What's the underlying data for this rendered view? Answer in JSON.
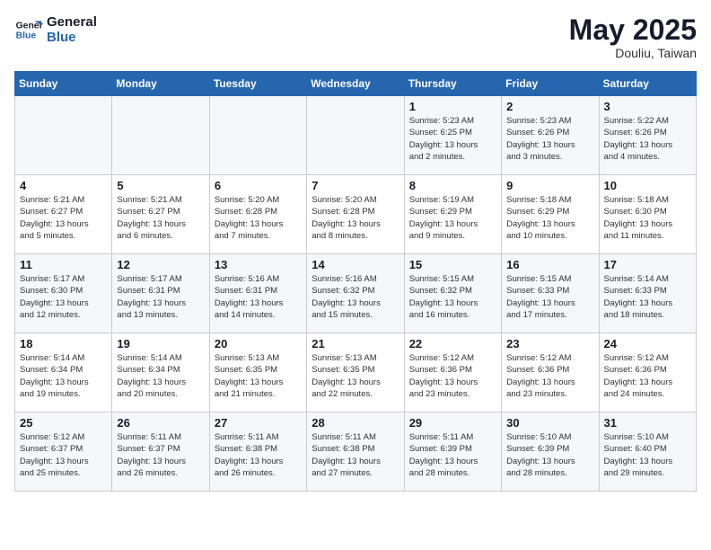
{
  "logo": {
    "line1": "General",
    "line2": "Blue"
  },
  "title": "May 2025",
  "location": "Douliu, Taiwan",
  "days_of_week": [
    "Sunday",
    "Monday",
    "Tuesday",
    "Wednesday",
    "Thursday",
    "Friday",
    "Saturday"
  ],
  "weeks": [
    [
      {
        "day": "",
        "info": ""
      },
      {
        "day": "",
        "info": ""
      },
      {
        "day": "",
        "info": ""
      },
      {
        "day": "",
        "info": ""
      },
      {
        "day": "1",
        "info": "Sunrise: 5:23 AM\nSunset: 6:25 PM\nDaylight: 13 hours\nand 2 minutes."
      },
      {
        "day": "2",
        "info": "Sunrise: 5:23 AM\nSunset: 6:26 PM\nDaylight: 13 hours\nand 3 minutes."
      },
      {
        "day": "3",
        "info": "Sunrise: 5:22 AM\nSunset: 6:26 PM\nDaylight: 13 hours\nand 4 minutes."
      }
    ],
    [
      {
        "day": "4",
        "info": "Sunrise: 5:21 AM\nSunset: 6:27 PM\nDaylight: 13 hours\nand 5 minutes."
      },
      {
        "day": "5",
        "info": "Sunrise: 5:21 AM\nSunset: 6:27 PM\nDaylight: 13 hours\nand 6 minutes."
      },
      {
        "day": "6",
        "info": "Sunrise: 5:20 AM\nSunset: 6:28 PM\nDaylight: 13 hours\nand 7 minutes."
      },
      {
        "day": "7",
        "info": "Sunrise: 5:20 AM\nSunset: 6:28 PM\nDaylight: 13 hours\nand 8 minutes."
      },
      {
        "day": "8",
        "info": "Sunrise: 5:19 AM\nSunset: 6:29 PM\nDaylight: 13 hours\nand 9 minutes."
      },
      {
        "day": "9",
        "info": "Sunrise: 5:18 AM\nSunset: 6:29 PM\nDaylight: 13 hours\nand 10 minutes."
      },
      {
        "day": "10",
        "info": "Sunrise: 5:18 AM\nSunset: 6:30 PM\nDaylight: 13 hours\nand 11 minutes."
      }
    ],
    [
      {
        "day": "11",
        "info": "Sunrise: 5:17 AM\nSunset: 6:30 PM\nDaylight: 13 hours\nand 12 minutes."
      },
      {
        "day": "12",
        "info": "Sunrise: 5:17 AM\nSunset: 6:31 PM\nDaylight: 13 hours\nand 13 minutes."
      },
      {
        "day": "13",
        "info": "Sunrise: 5:16 AM\nSunset: 6:31 PM\nDaylight: 13 hours\nand 14 minutes."
      },
      {
        "day": "14",
        "info": "Sunrise: 5:16 AM\nSunset: 6:32 PM\nDaylight: 13 hours\nand 15 minutes."
      },
      {
        "day": "15",
        "info": "Sunrise: 5:15 AM\nSunset: 6:32 PM\nDaylight: 13 hours\nand 16 minutes."
      },
      {
        "day": "16",
        "info": "Sunrise: 5:15 AM\nSunset: 6:33 PM\nDaylight: 13 hours\nand 17 minutes."
      },
      {
        "day": "17",
        "info": "Sunrise: 5:14 AM\nSunset: 6:33 PM\nDaylight: 13 hours\nand 18 minutes."
      }
    ],
    [
      {
        "day": "18",
        "info": "Sunrise: 5:14 AM\nSunset: 6:34 PM\nDaylight: 13 hours\nand 19 minutes."
      },
      {
        "day": "19",
        "info": "Sunrise: 5:14 AM\nSunset: 6:34 PM\nDaylight: 13 hours\nand 20 minutes."
      },
      {
        "day": "20",
        "info": "Sunrise: 5:13 AM\nSunset: 6:35 PM\nDaylight: 13 hours\nand 21 minutes."
      },
      {
        "day": "21",
        "info": "Sunrise: 5:13 AM\nSunset: 6:35 PM\nDaylight: 13 hours\nand 22 minutes."
      },
      {
        "day": "22",
        "info": "Sunrise: 5:12 AM\nSunset: 6:36 PM\nDaylight: 13 hours\nand 23 minutes."
      },
      {
        "day": "23",
        "info": "Sunrise: 5:12 AM\nSunset: 6:36 PM\nDaylight: 13 hours\nand 23 minutes."
      },
      {
        "day": "24",
        "info": "Sunrise: 5:12 AM\nSunset: 6:36 PM\nDaylight: 13 hours\nand 24 minutes."
      }
    ],
    [
      {
        "day": "25",
        "info": "Sunrise: 5:12 AM\nSunset: 6:37 PM\nDaylight: 13 hours\nand 25 minutes."
      },
      {
        "day": "26",
        "info": "Sunrise: 5:11 AM\nSunset: 6:37 PM\nDaylight: 13 hours\nand 26 minutes."
      },
      {
        "day": "27",
        "info": "Sunrise: 5:11 AM\nSunset: 6:38 PM\nDaylight: 13 hours\nand 26 minutes."
      },
      {
        "day": "28",
        "info": "Sunrise: 5:11 AM\nSunset: 6:38 PM\nDaylight: 13 hours\nand 27 minutes."
      },
      {
        "day": "29",
        "info": "Sunrise: 5:11 AM\nSunset: 6:39 PM\nDaylight: 13 hours\nand 28 minutes."
      },
      {
        "day": "30",
        "info": "Sunrise: 5:10 AM\nSunset: 6:39 PM\nDaylight: 13 hours\nand 28 minutes."
      },
      {
        "day": "31",
        "info": "Sunrise: 5:10 AM\nSunset: 6:40 PM\nDaylight: 13 hours\nand 29 minutes."
      }
    ]
  ]
}
